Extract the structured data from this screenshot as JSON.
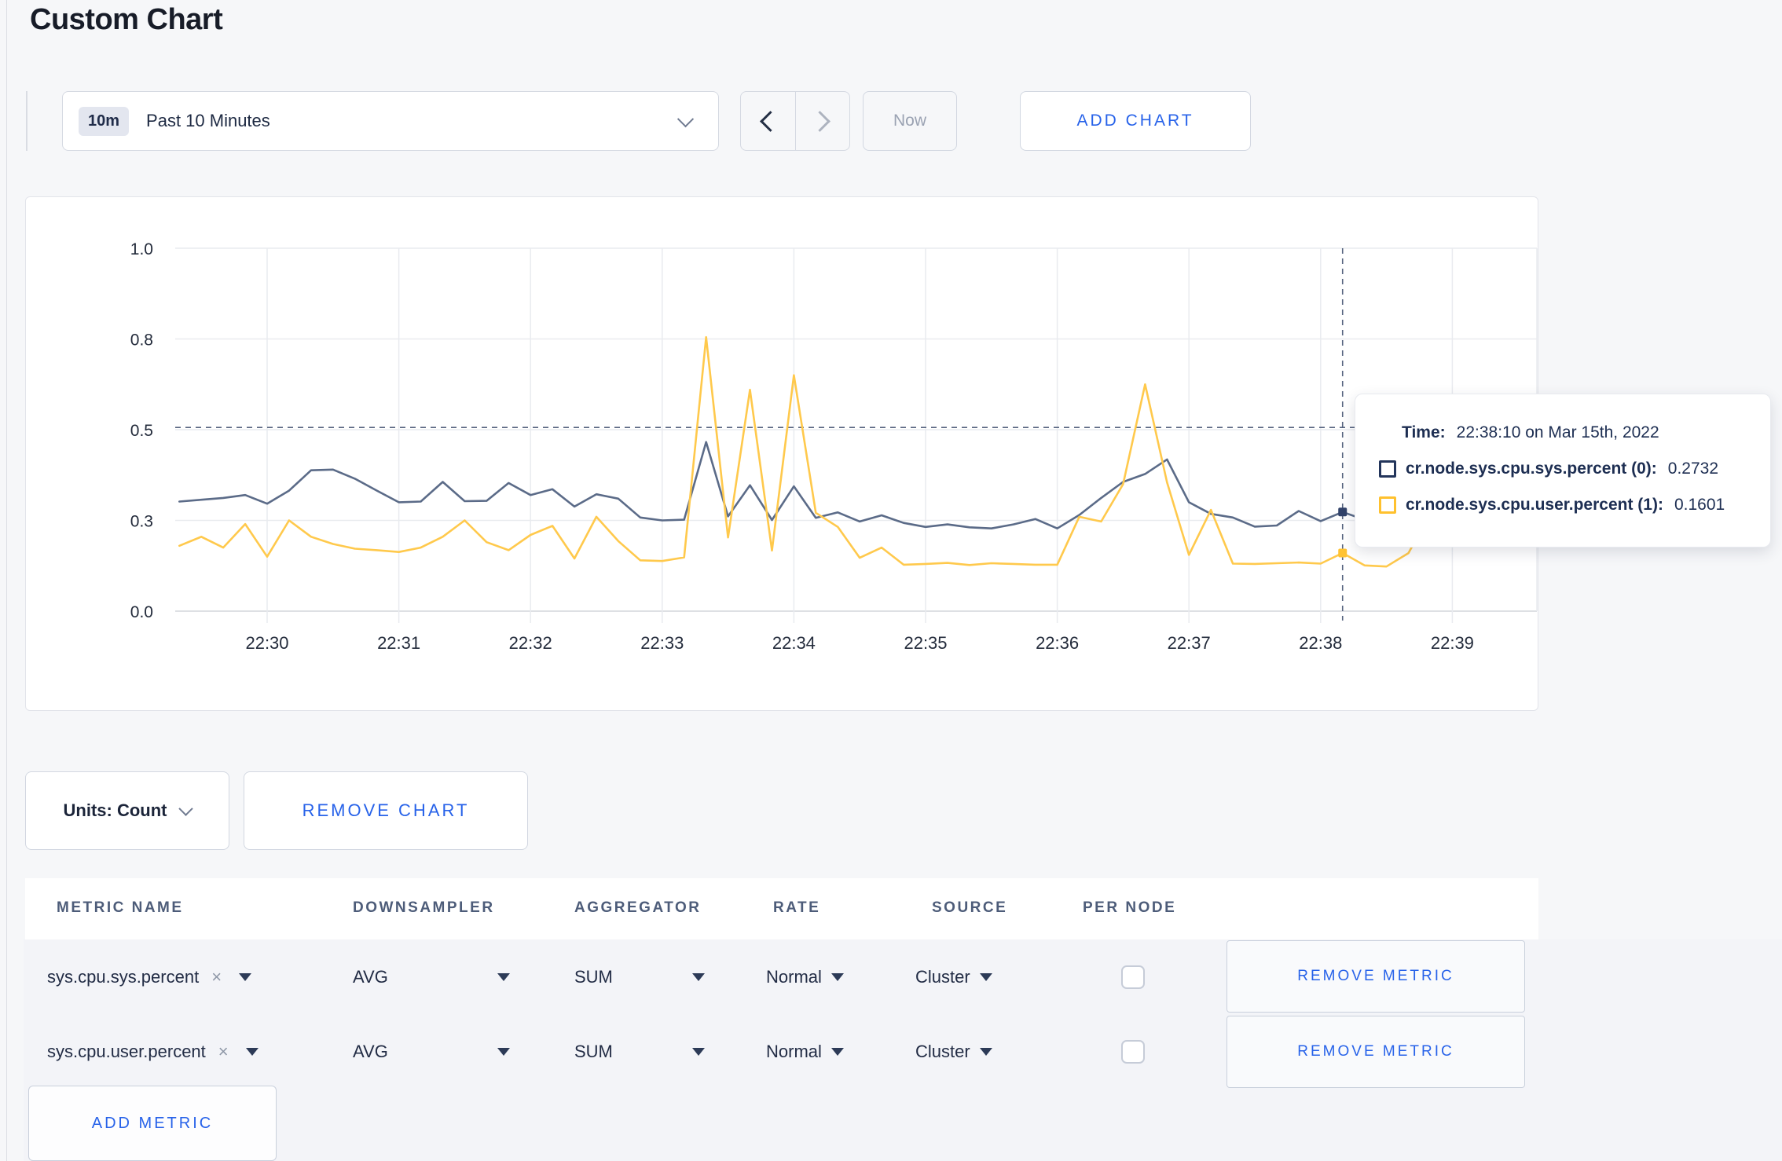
{
  "page": {
    "title": "Custom Chart"
  },
  "toolbar": {
    "range_badge": "10m",
    "range_label": "Past 10 Minutes",
    "now_label": "Now",
    "add_chart_label": "ADD CHART"
  },
  "chart_controls": {
    "units_label": "Units: Count",
    "remove_chart_label": "REMOVE CHART"
  },
  "tooltip": {
    "time_label": "Time:",
    "time_value": "22:38:10 on Mar 15th, 2022",
    "series": [
      {
        "name": "cr.node.sys.cpu.sys.percent (0):",
        "value": "0.2732",
        "swatch_color": "#23355b"
      },
      {
        "name": "cr.node.sys.cpu.user.percent (1):",
        "value": "0.1601",
        "swatch_color": "#ffc12e"
      }
    ]
  },
  "metrics_table": {
    "headers": [
      "METRIC NAME",
      "DOWNSAMPLER",
      "AGGREGATOR",
      "RATE",
      "SOURCE",
      "PER NODE"
    ],
    "remove_icon": "×",
    "rows": [
      {
        "metric": "sys.cpu.sys.percent",
        "downsampler": "AVG",
        "aggregator": "SUM",
        "rate": "Normal",
        "source": "Cluster",
        "per_node_checked": false,
        "remove_label": "REMOVE METRIC"
      },
      {
        "metric": "sys.cpu.user.percent",
        "downsampler": "AVG",
        "aggregator": "SUM",
        "rate": "Normal",
        "source": "Cluster",
        "per_node_checked": false,
        "remove_label": "REMOVE METRIC"
      }
    ],
    "add_metric_label": "ADD METRIC"
  },
  "chart_data": {
    "type": "line",
    "title": "",
    "xlabel": "",
    "ylabel": "",
    "ylim": [
      0,
      1.0
    ],
    "grid": true,
    "x_ticks": [
      "22:30",
      "22:31",
      "22:32",
      "22:33",
      "22:34",
      "22:35",
      "22:36",
      "22:37",
      "22:38",
      "22:39"
    ],
    "y_ticks": [
      {
        "label": "1.0",
        "value": 1.0
      },
      {
        "label": "0.8",
        "value": 0.75
      },
      {
        "label": "0.5",
        "value": 0.5
      },
      {
        "label": "0.3",
        "value": 0.25
      },
      {
        "label": "0.0",
        "value": 0.0
      }
    ],
    "x_start_minutes": -0.6667,
    "x_step_minutes": 0.16667,
    "series": [
      {
        "name": "cr.node.sys.cpu.sys.percent",
        "color": "#5b6b88",
        "values": [
          0.302,
          0.307,
          0.312,
          0.32,
          0.296,
          0.332,
          0.388,
          0.39,
          0.365,
          0.332,
          0.3,
          0.302,
          0.356,
          0.303,
          0.304,
          0.353,
          0.32,
          0.336,
          0.288,
          0.322,
          0.31,
          0.258,
          0.25,
          0.252,
          0.466,
          0.261,
          0.347,
          0.251,
          0.344,
          0.257,
          0.272,
          0.247,
          0.264,
          0.243,
          0.232,
          0.239,
          0.231,
          0.228,
          0.239,
          0.254,
          0.228,
          0.265,
          0.312,
          0.356,
          0.378,
          0.418,
          0.3,
          0.268,
          0.258,
          0.233,
          0.236,
          0.276,
          0.248,
          0.2732,
          0.252,
          0.261,
          0.266,
          0.256,
          0.263,
          0.257
        ]
      },
      {
        "name": "cr.node.sys.cpu.user.percent",
        "color": "#ffc94c",
        "values": [
          0.18,
          0.205,
          0.175,
          0.24,
          0.15,
          0.25,
          0.205,
          0.185,
          0.172,
          0.168,
          0.163,
          0.175,
          0.205,
          0.25,
          0.19,
          0.168,
          0.21,
          0.235,
          0.145,
          0.26,
          0.193,
          0.14,
          0.138,
          0.148,
          0.755,
          0.203,
          0.61,
          0.167,
          0.65,
          0.271,
          0.232,
          0.147,
          0.175,
          0.128,
          0.13,
          0.133,
          0.127,
          0.132,
          0.13,
          0.128,
          0.128,
          0.26,
          0.247,
          0.35,
          0.625,
          0.355,
          0.155,
          0.279,
          0.131,
          0.13,
          0.132,
          0.134,
          0.131,
          0.1601,
          0.126,
          0.123,
          0.16,
          0.27,
          0.2,
          0.24
        ]
      }
    ],
    "crosshair": {
      "x_minutes": 8.1667,
      "y_value": 0.506,
      "points": [
        {
          "value": 0.2732,
          "color": "#32436a"
        },
        {
          "value": 0.1601,
          "color": "#ffc333"
        }
      ]
    }
  }
}
